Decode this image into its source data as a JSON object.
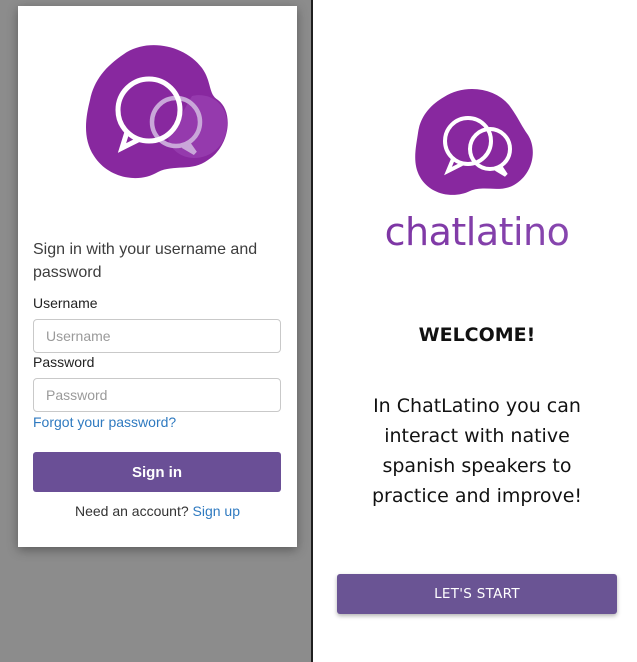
{
  "signin": {
    "heading": "Sign in with your username and password",
    "username_label": "Username",
    "username_placeholder": "Username",
    "username_value": "",
    "password_label": "Password",
    "password_placeholder": "Password",
    "password_value": "",
    "forgot_link": "Forgot your password?",
    "submit_label": "Sign in",
    "signup_prompt": "Need an account?",
    "signup_link": "Sign up"
  },
  "welcome": {
    "brand_name": "chatlatino",
    "heading": "WELCOME!",
    "message": "In ChatLatino you can interact with native spanish speakers to practice and improve!",
    "start_label": "LET'S START"
  },
  "icons": {
    "card_logo": "chat-bubbles-logo-icon",
    "brand_logo": "chat-bubbles-logo-icon"
  },
  "colors": {
    "brand_purple": "#8a2fa0",
    "button_purple": "#6a4f96",
    "link_blue": "#2f7ac0",
    "backdrop_gray": "#8c8c8c"
  }
}
